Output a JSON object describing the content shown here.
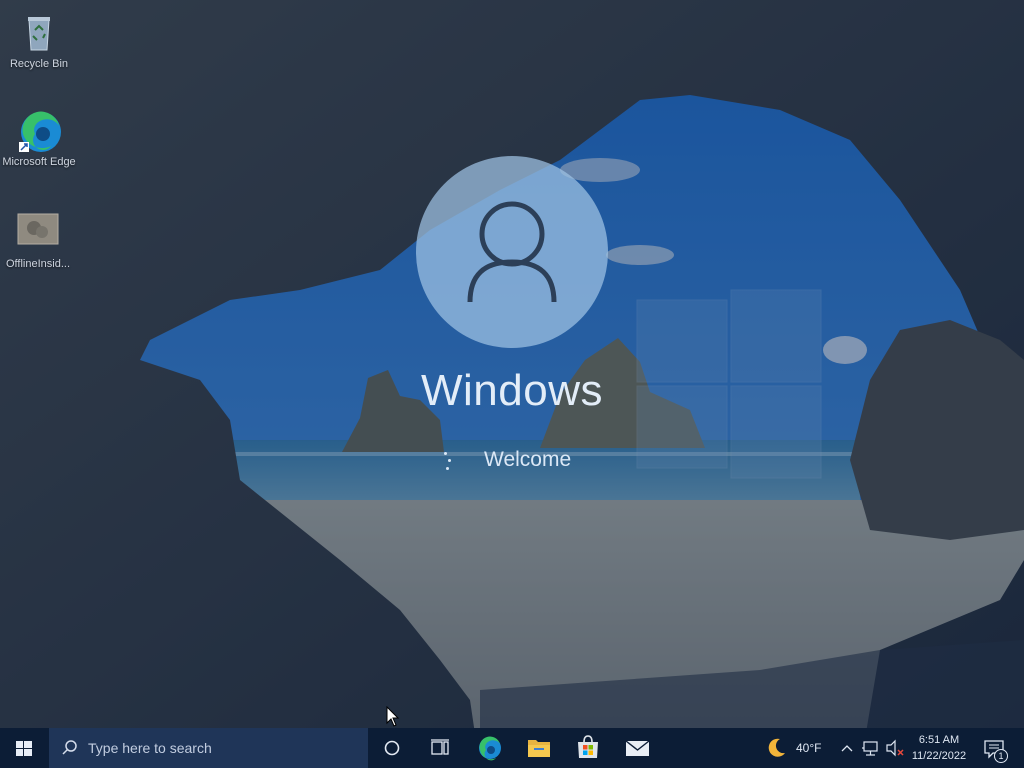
{
  "desktop": {
    "icons": [
      {
        "label": "Recycle Bin",
        "icon": "recycle-bin-icon"
      },
      {
        "label": "Microsoft Edge",
        "icon": "edge-icon"
      },
      {
        "label": "OfflineInsid...",
        "icon": "offline-insider-icon"
      }
    ]
  },
  "welcome": {
    "user_name": "Windows",
    "status": "Welcome",
    "avatar_icon": "user-avatar-icon"
  },
  "taskbar": {
    "search_placeholder": "Type here to search",
    "pinned": [
      {
        "name": "cortana",
        "icon": "cortana-icon"
      },
      {
        "name": "task-view",
        "icon": "task-view-icon"
      },
      {
        "name": "edge",
        "icon": "edge-icon"
      },
      {
        "name": "file-explorer",
        "icon": "folder-icon"
      },
      {
        "name": "store",
        "icon": "store-icon"
      },
      {
        "name": "mail",
        "icon": "mail-icon"
      }
    ],
    "tray": {
      "weather_temp": "40°F",
      "weather_icon": "moon-icon",
      "time": "6:51 AM",
      "date": "11/22/2022",
      "notification_count": "1"
    }
  },
  "colors": {
    "taskbar": "#0c1d36",
    "search_box": "#1f3558",
    "avatar_circle": "#a0c4e4"
  }
}
